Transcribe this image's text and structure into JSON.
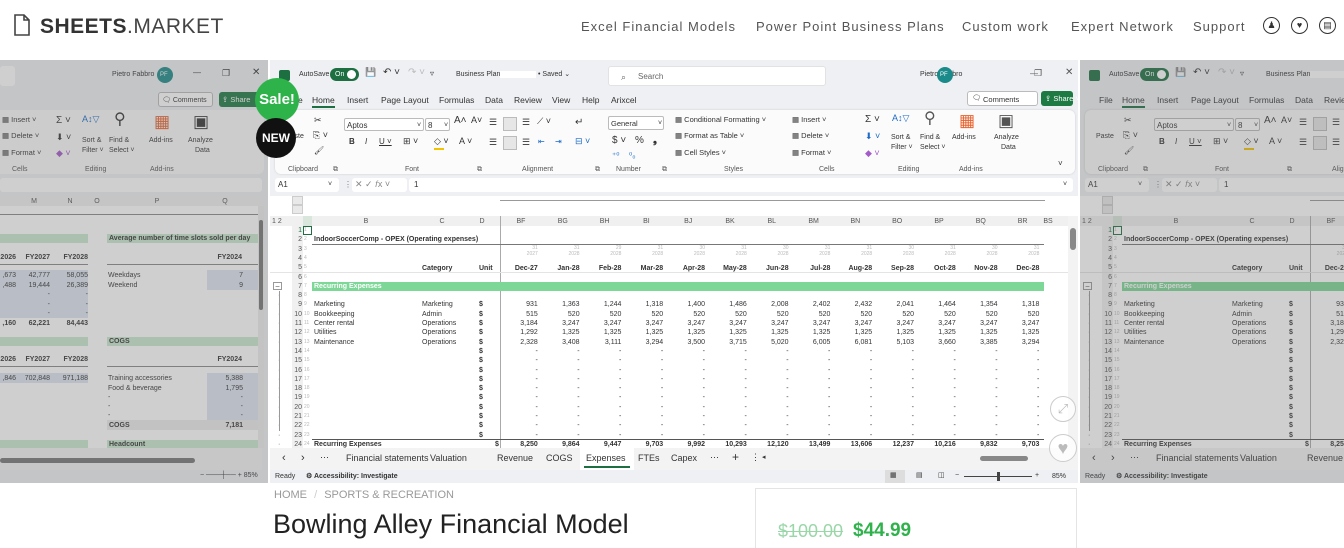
{
  "site": {
    "logo_bold": "SHEETS",
    "logo_rest": ".MARKET",
    "nav": [
      "Excel Financial Models",
      "Power Point Business Plans",
      "Custom work",
      "Expert Network",
      "Support"
    ],
    "icons": [
      "user-icon",
      "heart-icon",
      "cart-icon"
    ]
  },
  "badges": {
    "sale": "Sale!",
    "new": "NEW",
    "sale_color": "#2db34a",
    "new_color": "#111111"
  },
  "excel": {
    "autosave": "AutoSave",
    "toggle": "On",
    "doc_title": "Business Plan",
    "saved": "• Saved ⌄",
    "search": "Search",
    "user": "Pietro Fabbro",
    "initials": "PF",
    "comments": "Comments",
    "share": "Share",
    "tabs": [
      "File",
      "Home",
      "Insert",
      "Page Layout",
      "Formulas",
      "Data",
      "Review",
      "View",
      "Help",
      "Arixcel"
    ],
    "active_tab": "Home",
    "ribbon": {
      "paste": "Paste",
      "clipboard": "Clipboard",
      "font_name": "Aptos",
      "font_size": "8",
      "font": "Font",
      "alignment": "Alignment",
      "number_format": "General",
      "number": "Number",
      "cond_fmt": "Conditional Formatting",
      "fmt_table": "Format as Table",
      "cell_styles": "Cell Styles",
      "styles": "Styles",
      "insert": "Insert",
      "delete": "Delete",
      "format": "Format",
      "cells": "Cells",
      "sort": "Sort &",
      "filter": "Filter",
      "find": "Find &",
      "select": "Select",
      "editing": "Editing",
      "addins": "Add-ins",
      "analyze1": "Analyze",
      "analyze2": "Data"
    },
    "namebox": "A1",
    "formula": "1",
    "columns": [
      "A",
      "B",
      "C",
      "D",
      "BF",
      "BG",
      "BH",
      "BI",
      "BJ",
      "BK",
      "BL",
      "BM",
      "BN",
      "BO",
      "BP",
      "BQ",
      "BR",
      "BS"
    ],
    "sheet_title": "IndoorSoccerComp - OPEX (Operating expenses)",
    "col_headers": {
      "category": "Category",
      "unit": "Unit"
    },
    "months": [
      "Dec-27",
      "Jan-28",
      "Feb-28",
      "Mar-28",
      "Apr-28",
      "May-28",
      "Jun-28",
      "Jul-28",
      "Aug-28",
      "Sep-28",
      "Oct-28",
      "Nov-28",
      "Dec-28"
    ],
    "days": [
      "31",
      "31",
      "29",
      "31",
      "30",
      "31",
      "30",
      "31",
      "31",
      "30",
      "31",
      "30",
      "31"
    ],
    "years": [
      "2027",
      "2028",
      "2028",
      "2028",
      "2028",
      "2028",
      "2028",
      "2028",
      "2028",
      "2028",
      "2028",
      "2028",
      "2028"
    ],
    "section": "Recurring Expenses",
    "section_color": "#7dd897",
    "rows": [
      {
        "name": "Marketing",
        "category": "Marketing",
        "unit": "$",
        "values": [
          931,
          1363,
          1244,
          1318,
          1400,
          1486,
          2008,
          2402,
          2432,
          2041,
          1464,
          1354,
          1318
        ]
      },
      {
        "name": "Bookkeeping",
        "category": "Admin",
        "unit": "$",
        "values": [
          515,
          520,
          520,
          520,
          520,
          520,
          520,
          520,
          520,
          520,
          520,
          520,
          520
        ]
      },
      {
        "name": "Center rental",
        "category": "Operations",
        "unit": "$",
        "values": [
          3184,
          3247,
          3247,
          3247,
          3247,
          3247,
          3247,
          3247,
          3247,
          3247,
          3247,
          3247,
          3247
        ]
      },
      {
        "name": "Utilities",
        "category": "Operations",
        "unit": "$",
        "values": [
          1292,
          1325,
          1325,
          1325,
          1325,
          1325,
          1325,
          1325,
          1325,
          1325,
          1325,
          1325,
          1325
        ]
      },
      {
        "name": "Maintenance",
        "category": "Operations",
        "unit": "$",
        "values": [
          2328,
          3408,
          3111,
          3294,
          3500,
          3715,
          5020,
          6005,
          6081,
          5103,
          3660,
          3385,
          3294
        ]
      }
    ],
    "empty_unit": "$",
    "empty_value": "-",
    "total": {
      "name": "Recurring Expenses",
      "unit": "$",
      "values": [
        8250,
        9864,
        9447,
        9703,
        9992,
        10293,
        12120,
        13499,
        13606,
        12237,
        10216,
        9832,
        9703
      ]
    },
    "sheet_tabs": [
      "Financial statements",
      "Valuation",
      "Revenue",
      "COGS",
      "Expenses",
      "FTEs",
      "Capex"
    ],
    "active_sheet": "Expenses",
    "status": "Ready",
    "accessibility": "Accessibility: Investigate",
    "zoom": "85%"
  },
  "left_panel": {
    "columns": [
      "M",
      "N",
      "O",
      "P",
      "Q"
    ],
    "section1": "Average number of time slots sold per day",
    "fy": [
      "2026",
      "FY2027",
      "FY2028"
    ],
    "fy_right": "FY2024",
    "rows1": [
      [
        ",673",
        "42,777",
        "58,055"
      ],
      [
        ",488",
        "19,444",
        "26,389"
      ]
    ],
    "labels1": [
      {
        "label": "Weekdays",
        "value": "7"
      },
      {
        "label": "Weekend",
        "value": "9"
      }
    ],
    "total1": [
      ",160",
      "62,221",
      "84,443"
    ],
    "section2": "COGS",
    "rows2": [
      ",846",
      "702,848",
      "971,188"
    ],
    "labels2": [
      {
        "label": "Training accessories",
        "value": "5,388"
      },
      {
        "label": "Food & beverage",
        "value": "1,795"
      }
    ],
    "total2": {
      "label": "COGS",
      "value": "7,181"
    },
    "section3": "Headcount"
  },
  "product": {
    "breadcrumb": [
      "HOME",
      "SPORTS & RECREATION"
    ],
    "title": "Bowling Alley Financial Model",
    "old_price": "$100.00",
    "price": "$44.99",
    "price_color": "#2fb24c"
  }
}
